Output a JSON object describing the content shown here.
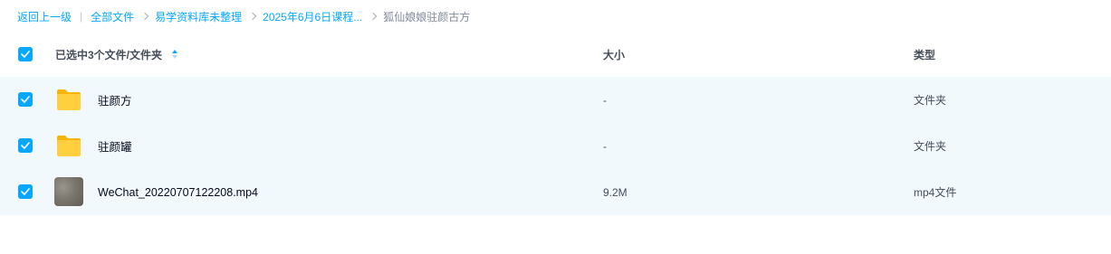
{
  "breadcrumb": {
    "back": "返回上一级",
    "separator": "|",
    "items": [
      "全部文件",
      "易学资料库未整理",
      "2025年6月6日课程..."
    ],
    "current": "狐仙娘娘驻颜古方"
  },
  "header": {
    "selection_label": "已选中3个文件/文件夹",
    "col_size": "大小",
    "col_type": "类型",
    "checked": true
  },
  "files": [
    {
      "name": "驻颜方",
      "size": "-",
      "type": "文件夹",
      "icon": "folder-icon",
      "checked": true
    },
    {
      "name": "驻颜罐",
      "size": "-",
      "type": "文件夹",
      "icon": "folder-icon",
      "checked": true
    },
    {
      "name": "WeChat_20220707122208.mp4",
      "size": "9.2M",
      "type": "mp4文件",
      "icon": "video-thumbnail",
      "checked": true
    }
  ],
  "colors": {
    "accent": "#06a7ff",
    "selected_row_bg": "#f2f9fd",
    "folder": "#ffcf3d"
  }
}
